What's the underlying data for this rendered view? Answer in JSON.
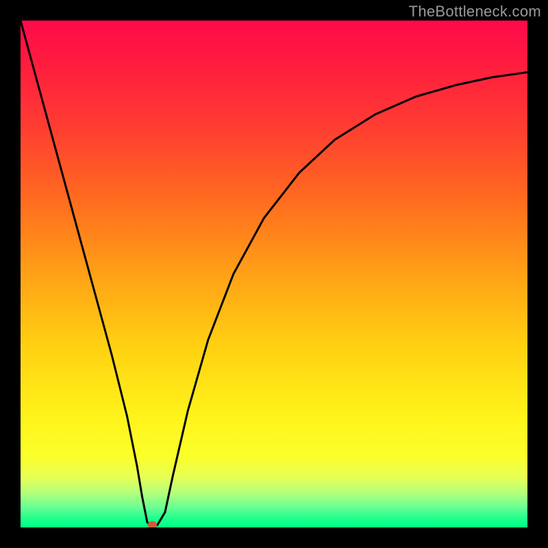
{
  "watermark": "TheBottleneck.com",
  "chart_data": {
    "type": "line",
    "title": "",
    "xlabel": "",
    "ylabel": "",
    "xlim": [
      0,
      100
    ],
    "ylim": [
      0,
      100
    ],
    "series": [
      {
        "name": "curve",
        "x": [
          0,
          3,
          6,
          9,
          12,
          15,
          18,
          21,
          23,
          24,
          25,
          26,
          27,
          28.5,
          30,
          33,
          37,
          42,
          48,
          55,
          62,
          70,
          78,
          86,
          93,
          100
        ],
        "values": [
          100,
          89,
          78,
          67,
          56,
          45,
          34,
          22,
          12,
          6,
          1,
          0,
          0.5,
          3,
          10,
          23,
          37,
          50,
          61,
          70,
          76.5,
          81.5,
          85,
          87.3,
          88.8,
          89.8
        ]
      }
    ],
    "marker": {
      "x": 26,
      "y": 0,
      "color": "#cf5a3c"
    },
    "gradient_stops": [
      {
        "pos": 0,
        "color": "#ff0a4a"
      },
      {
        "pos": 0.2,
        "color": "#ff3a33"
      },
      {
        "pos": 0.5,
        "color": "#ffa116"
      },
      {
        "pos": 0.78,
        "color": "#fff31a"
      },
      {
        "pos": 0.96,
        "color": "#6aff93"
      },
      {
        "pos": 1.0,
        "color": "#00ff84"
      }
    ]
  }
}
